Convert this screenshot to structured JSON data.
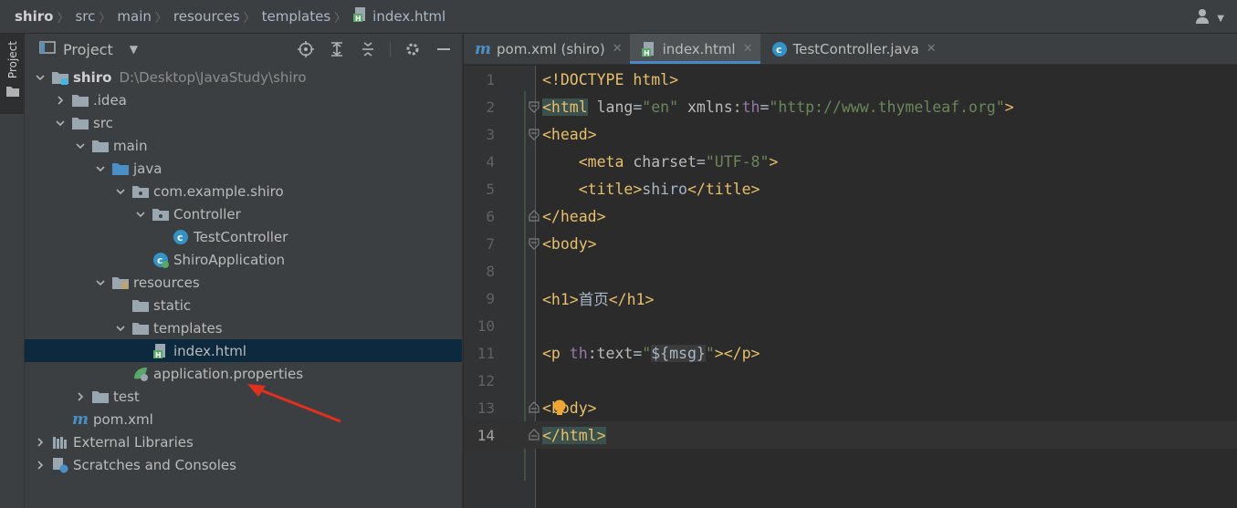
{
  "breadcrumb": [
    {
      "label": "shiro"
    },
    {
      "label": "src"
    },
    {
      "label": "main"
    },
    {
      "label": "resources"
    },
    {
      "label": "templates"
    },
    {
      "label": "index.html"
    }
  ],
  "tool_window_stripe": {
    "label": "Project"
  },
  "project_panel": {
    "title": "Project"
  },
  "tree": [
    {
      "label": "shiro",
      "path": "D:\\Desktop\\JavaStudy\\shiro"
    },
    {
      "label": ".idea"
    },
    {
      "label": "src"
    },
    {
      "label": "main"
    },
    {
      "label": "java"
    },
    {
      "label": "com.example.shiro"
    },
    {
      "label": "Controller"
    },
    {
      "label": "TestController"
    },
    {
      "label": "ShiroApplication"
    },
    {
      "label": "resources"
    },
    {
      "label": "static"
    },
    {
      "label": "templates"
    },
    {
      "label": "index.html"
    },
    {
      "label": "application.properties"
    },
    {
      "label": "test"
    },
    {
      "label": "pom.xml"
    },
    {
      "label": "External Libraries"
    },
    {
      "label": "Scratches and Consoles"
    }
  ],
  "tabs": [
    {
      "label": "pom.xml (shiro)"
    },
    {
      "label": "index.html"
    },
    {
      "label": "TestController.java"
    }
  ],
  "line_numbers": [
    "1",
    "2",
    "3",
    "4",
    "5",
    "6",
    "7",
    "8",
    "9",
    "10",
    "11",
    "12",
    "13",
    "14"
  ],
  "code": {
    "l1": {
      "a": "<!DOCTYPE html>"
    },
    "l2": {
      "a": "<html",
      "b": " lang",
      "c": "=",
      "d": "\"en\"",
      "e": " xmlns:",
      "f": "th",
      "g": "=",
      "h": "\"http://www.thymeleaf.org\"",
      "i": ">"
    },
    "l3": {
      "a": "<head>"
    },
    "l4": {
      "indent": "    ",
      "a": "<meta",
      "b": " charset",
      "c": "=",
      "d": "\"UTF-8\"",
      "e": ">"
    },
    "l5": {
      "indent": "    ",
      "a": "<title>",
      "b": "shiro",
      "c": "</title>"
    },
    "l6": {
      "a": "</head>"
    },
    "l7": {
      "a": "<body>"
    },
    "l9": {
      "a": "<h1>",
      "b": "首页",
      "c": "</h1>"
    },
    "l11": {
      "a": "<p",
      "b": " th",
      "c": ":text",
      "d": "=",
      "e": "\"",
      "f": "${msg}",
      "g": "\"",
      "h": "></p>"
    },
    "l13": {
      "a": "<",
      "b": "body>"
    },
    "l14": {
      "a": "</html>"
    }
  }
}
